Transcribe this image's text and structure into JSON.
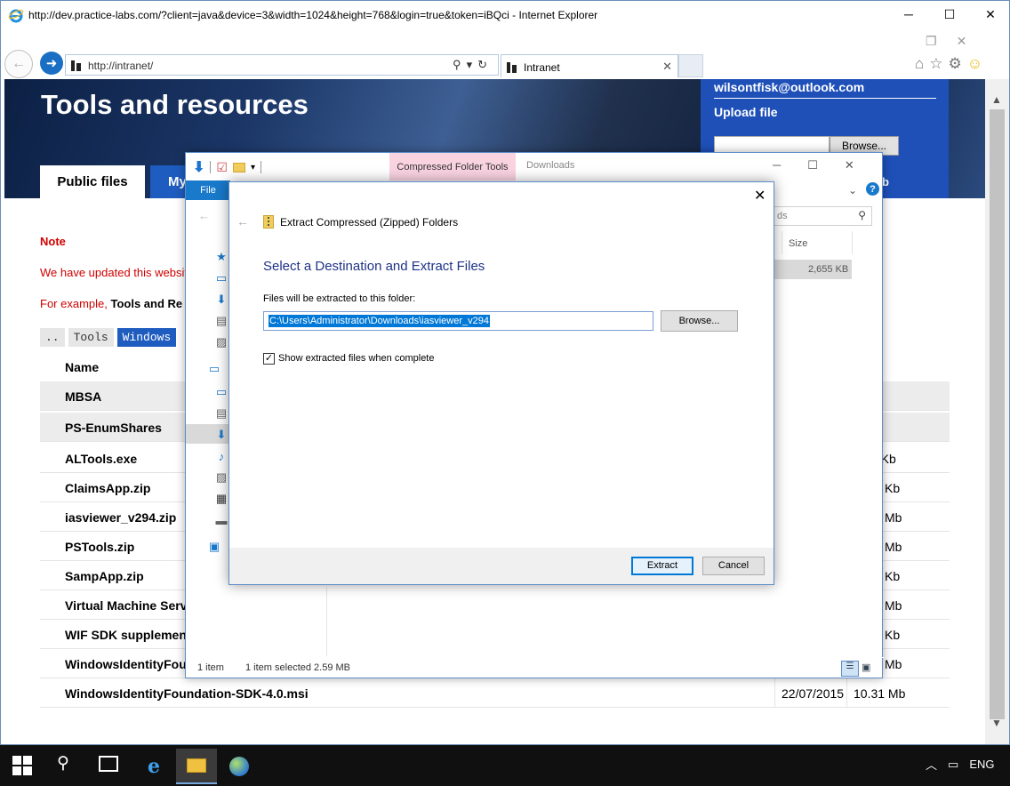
{
  "ie": {
    "title": "http://dev.practice-labs.com/?client=java&device=3&width=1024&height=768&login=true&token=iBQci - Internet Explorer",
    "address": "http://intranet/",
    "tab_label": "Intranet",
    "win_minimize": "─",
    "win_maximize": "☐",
    "win_close": "✕"
  },
  "page": {
    "banner_title": "Tools and resources",
    "tabs": [
      "Public files",
      "My"
    ],
    "upload": {
      "email": "wilsontfisk@outlook.com",
      "title": "Upload file",
      "browse_label": "Browse...",
      "hint_fragment": "b"
    },
    "note_label": "Note",
    "note_text": "We have updated this websit",
    "example_prefix": "For example,",
    "example_bold": "Tools and Re",
    "crumbs": [
      "..",
      "Tools",
      "Windows"
    ],
    "files_header": "Name",
    "files": [
      {
        "name": "MBSA",
        "date": "",
        "size": "",
        "dir": true
      },
      {
        "name": "PS-EnumShares",
        "date": "",
        "size": "",
        "dir": true
      },
      {
        "name": "ALTools.exe",
        "date": "",
        "size": "5 Kb",
        "dir": false
      },
      {
        "name": "ClaimsApp.zip",
        "date": "",
        "size": "Kb",
        "dir": false
      },
      {
        "name": "iasviewer_v294.zip",
        "date": "",
        "size": "Mb",
        "dir": false
      },
      {
        "name": "PSTools.zip",
        "date": "",
        "size": "Mb",
        "dir": false
      },
      {
        "name": "SampApp.zip",
        "date": "",
        "size": "Kb",
        "dir": false
      },
      {
        "name": "Virtual Machine Servi",
        "date": "",
        "size": "Mb",
        "dir": false
      },
      {
        "name": "WIF SDK supplementa",
        "date": "",
        "size": "Kb",
        "dir": false
      },
      {
        "name": "WindowsIdentityFoun",
        "date": "",
        "size": "Mb",
        "dir": false
      },
      {
        "name": "WindowsIdentityFoundation-SDK-4.0.msi",
        "date": "22/07/2015",
        "size": "10.31 Mb",
        "dir": false
      }
    ]
  },
  "explorer": {
    "context_tab": "Compressed Folder Tools",
    "downloads_tab": "Downloads",
    "file_tab": "File",
    "search_placeholder": "ds",
    "size_header": "Size",
    "selected_size": "2,655 KB",
    "status_items": "1 item",
    "status_selected": "1 item selected  2.59 MB"
  },
  "dialog": {
    "caption": "Extract Compressed (Zipped) Folders",
    "heading": "Select a Destination and Extract Files",
    "dest_label": "Files will be extracted to this folder:",
    "dest_path": "C:\\Users\\Administrator\\Downloads\\iasviewer_v294",
    "browse_label": "Browse...",
    "show_files_label": "Show extracted files when complete",
    "show_files_checked": true,
    "extract_label": "Extract",
    "cancel_label": "Cancel"
  },
  "taskbar": {
    "tray_language": "ENG"
  }
}
